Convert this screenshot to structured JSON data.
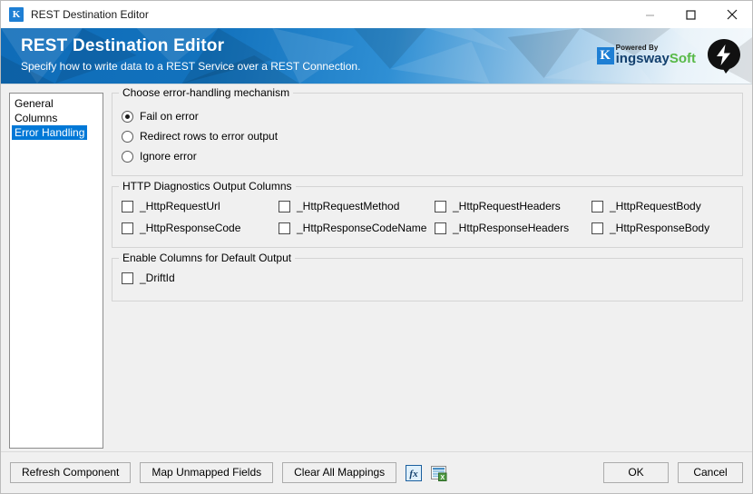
{
  "window": {
    "title": "REST Destination Editor",
    "app_icon": "kingswaysoft-k-icon",
    "controls": {
      "minimize": "minimize-icon",
      "maximize": "maximize-icon",
      "close": "close-icon"
    }
  },
  "banner": {
    "title": "REST Destination Editor",
    "subtitle": "Specify how to write data to a REST Service over a REST Connection.",
    "brand": {
      "badge": "K",
      "powered_by": "Powered By",
      "name_first": "ingsway",
      "name_second": "Soft",
      "bolt_icon": "lightning-bolt-icon"
    },
    "colors": {
      "blue": "#0f6cb8",
      "brand_dark": "#13406e",
      "brand_green": "#57b947"
    }
  },
  "nav": {
    "items": [
      {
        "label": "General",
        "selected": false
      },
      {
        "label": "Columns",
        "selected": false
      },
      {
        "label": "Error Handling",
        "selected": true
      }
    ],
    "selected_color": "#0078d7"
  },
  "error_handling": {
    "legend": "Choose error-handling mechanism",
    "options": [
      {
        "label": "Fail on error",
        "checked": true
      },
      {
        "label": "Redirect rows to error output",
        "checked": false
      },
      {
        "label": "Ignore error",
        "checked": false
      }
    ]
  },
  "http_diagnostics": {
    "legend": "HTTP Diagnostics Output Columns",
    "columns": [
      {
        "label": "_HttpRequestUrl",
        "checked": false
      },
      {
        "label": "_HttpRequestMethod",
        "checked": false
      },
      {
        "label": "_HttpRequestHeaders",
        "checked": false
      },
      {
        "label": "_HttpRequestBody",
        "checked": false
      },
      {
        "label": "_HttpResponseCode",
        "checked": false
      },
      {
        "label": "_HttpResponseCodeName",
        "checked": false
      },
      {
        "label": "_HttpResponseHeaders",
        "checked": false
      },
      {
        "label": "_HttpResponseBody",
        "checked": false
      }
    ]
  },
  "default_output": {
    "legend": "Enable Columns for Default Output",
    "columns": [
      {
        "label": "_DriftId",
        "checked": false
      }
    ]
  },
  "footer": {
    "refresh_component": "Refresh Component",
    "map_unmapped_fields": "Map Unmapped Fields",
    "clear_all_mappings": "Clear All Mappings",
    "expression_icon": "fx-expression-icon",
    "export_icon": "export-grid-icon",
    "ok": "OK",
    "cancel": "Cancel"
  }
}
